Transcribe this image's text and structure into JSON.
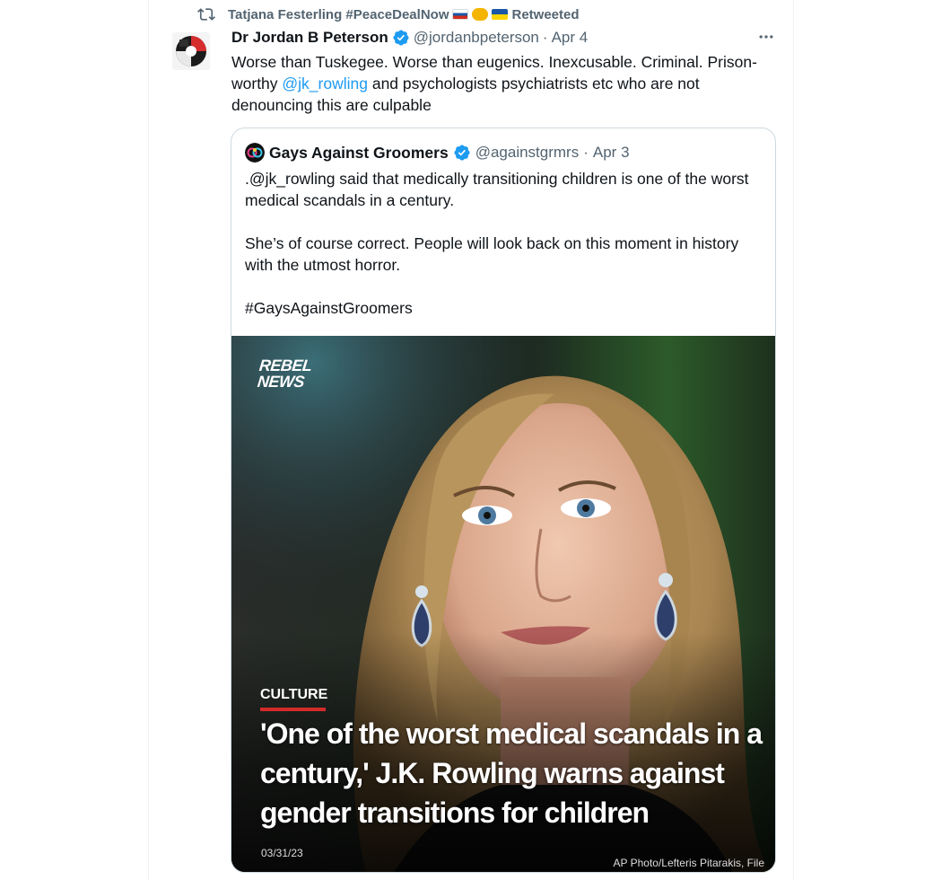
{
  "retweet": {
    "icon": "retweet-icon",
    "retweeter": "Tatjana Festerling #PeaceDealNow",
    "emojis": [
      "russian-flag",
      "handshake",
      "ukrainian-flag"
    ],
    "suffix": "Retweeted"
  },
  "tweet": {
    "author_name": "Dr Jordan B Peterson",
    "verified": true,
    "handle": "@jordanbpeterson",
    "separator": "·",
    "date": "Apr 4",
    "text_before_mention": "Worse than Tuskegee. Worse than eugenics. Inexcusable. Criminal. Prison-worthy ",
    "mention": "@jk_rowling",
    "text_after_mention": " and psychologists psychiatrists etc who are not denouncing this are culpable",
    "more_icon": "more-icon"
  },
  "quote": {
    "author_name": "Gays Against Groomers",
    "verified": true,
    "handle": "@againstgrmrs",
    "separator": "·",
    "date": "Apr 3",
    "paragraph1": ".@jk_rowling said that medically transitioning children is one of the worst medical scandals in a century.",
    "paragraph2": "She’s of course correct. People will look back on this moment in history with the utmost horror.",
    "paragraph3": "#GaysAgainstGroomers",
    "image": {
      "logo": "REBEL\nNEWS",
      "category": "CULTURE",
      "headline": "'One of the worst medical scandals in a century,' J.K. Rowling warns against gender transitions for children",
      "date": "03/31/23",
      "credit": "AP Photo/Lefteris Pitarakis, File"
    }
  },
  "colors": {
    "link": "#1d9bf0",
    "secondary_text": "#536471",
    "border": "#cfd9de",
    "accent_red": "#d42a2a"
  }
}
